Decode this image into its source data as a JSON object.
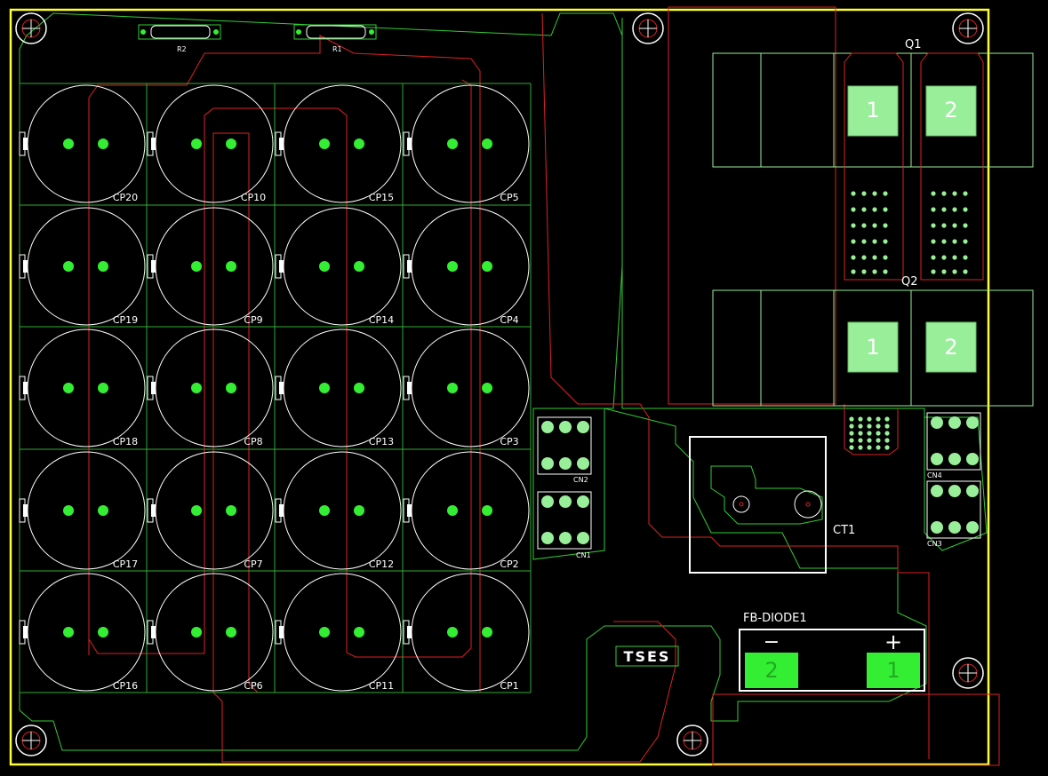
{
  "colors": {
    "background": "#000000",
    "board_outline": "#ffff33",
    "top_copper": "#33cc33",
    "bottom_copper": "#dd2222",
    "silkscreen": "#ffffff",
    "pad": "#33ee33",
    "pad_light": "#99ee99"
  },
  "resistors": [
    {
      "ref": "R2"
    },
    {
      "ref": "R1"
    }
  ],
  "capacitors": [
    {
      "ref": "CP20"
    },
    {
      "ref": "CP10"
    },
    {
      "ref": "CP15"
    },
    {
      "ref": "CP5"
    },
    {
      "ref": "CP19"
    },
    {
      "ref": "CP9"
    },
    {
      "ref": "CP14"
    },
    {
      "ref": "CP4"
    },
    {
      "ref": "CP18"
    },
    {
      "ref": "CP8"
    },
    {
      "ref": "CP13"
    },
    {
      "ref": "CP3"
    },
    {
      "ref": "CP17"
    },
    {
      "ref": "CP7"
    },
    {
      "ref": "CP12"
    },
    {
      "ref": "CP2"
    },
    {
      "ref": "CP16"
    },
    {
      "ref": "CP6"
    },
    {
      "ref": "CP11"
    },
    {
      "ref": "CP1"
    }
  ],
  "transistors": [
    {
      "ref": "Q1",
      "pad1": "1",
      "pad2": "2"
    },
    {
      "ref": "Q2",
      "pad1": "1",
      "pad2": "2"
    }
  ],
  "connectors": [
    "CN2",
    "CN1",
    "CN4",
    "CN3"
  ],
  "current_transformer": {
    "ref": "CT1"
  },
  "diode": {
    "ref": "FB-DIODE1",
    "pad_left": "2",
    "pad_right": "1",
    "minus": "−",
    "plus": "+"
  },
  "logo": "TSES"
}
